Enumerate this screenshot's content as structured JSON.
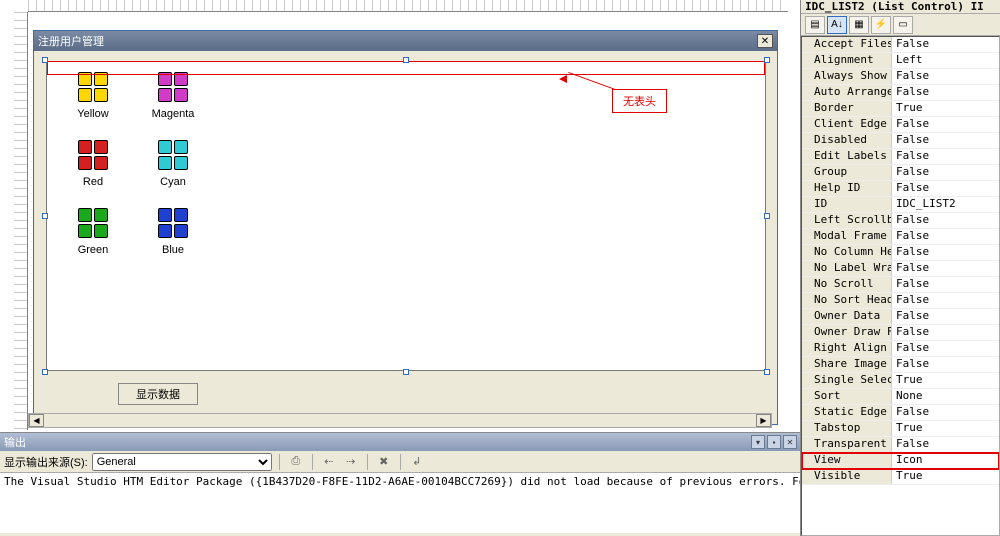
{
  "dialog": {
    "title": "注册用户管理"
  },
  "callout": "无表头",
  "icons": [
    [
      {
        "label": "Yellow",
        "cls": "yellow"
      },
      {
        "label": "Magenta",
        "cls": "magenta"
      }
    ],
    [
      {
        "label": "Red",
        "cls": "red"
      },
      {
        "label": "Cyan",
        "cls": "cyan"
      }
    ],
    [
      {
        "label": "Green",
        "cls": "green"
      },
      {
        "label": "Blue",
        "cls": "blue"
      }
    ]
  ],
  "show_data_btn": "显示数据",
  "output": {
    "title": "输出",
    "source_label": "显示输出来源(S):",
    "source_value": "General",
    "message": "The Visual Studio HTM Editor Package ({1B437D20-F8FE-11D2-A6AE-00104BCC7269}) did not load because of previous errors. For assis"
  },
  "props": {
    "title": "IDC_LIST2 (List Control) II",
    "rows": [
      {
        "name": "Accept Files",
        "val": "False"
      },
      {
        "name": "Alignment",
        "val": "Left"
      },
      {
        "name": "Always Show S",
        "val": "False"
      },
      {
        "name": "Auto Arrange",
        "val": "False"
      },
      {
        "name": "Border",
        "val": "True"
      },
      {
        "name": "Client Edge",
        "val": "False"
      },
      {
        "name": "Disabled",
        "val": "False"
      },
      {
        "name": "Edit Labels",
        "val": "False"
      },
      {
        "name": "Group",
        "val": "False"
      },
      {
        "name": "Help ID",
        "val": "False"
      },
      {
        "name": "ID",
        "val": "IDC_LIST2"
      },
      {
        "name": "Left Scrollba",
        "val": "False"
      },
      {
        "name": "Modal Frame",
        "val": "False"
      },
      {
        "name": "No Column Hea",
        "val": "False"
      },
      {
        "name": "No Label Wrap",
        "val": "False"
      },
      {
        "name": "No Scroll",
        "val": "False"
      },
      {
        "name": "No Sort Heade",
        "val": "False"
      },
      {
        "name": "Owner Data",
        "val": "False"
      },
      {
        "name": "Owner Draw Fi",
        "val": "False"
      },
      {
        "name": "Right Align T",
        "val": "False"
      },
      {
        "name": "Share Image L",
        "val": "False"
      },
      {
        "name": "Single Select",
        "val": "True"
      },
      {
        "name": "Sort",
        "val": "None"
      },
      {
        "name": "Static Edge",
        "val": "False"
      },
      {
        "name": "Tabstop",
        "val": "True"
      },
      {
        "name": "Transparent",
        "val": "False"
      },
      {
        "name": "View",
        "val": "Icon",
        "highlight": true
      },
      {
        "name": "Visible",
        "val": "True"
      }
    ]
  }
}
